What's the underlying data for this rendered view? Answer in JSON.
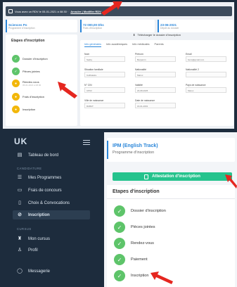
{
  "top_screen": {
    "rdv_bar": {
      "text": "Vous avez un RDV le 05-01-2021 à 08:30 ·",
      "link": "Annuler | Modifier RDV"
    },
    "stats": [
      {
        "value": "Sciences Po",
        "label": "Programme d'inscription"
      },
      {
        "value": "72 000,00 Dhs",
        "label": "Frais d'inscription"
      },
      {
        "value": "23-06-2021",
        "label": "Dépôt du dossier"
      }
    ],
    "download_label": "Télécharger le dossier d'inscription",
    "etapes_title": "Etapes d'inscription",
    "steps": [
      {
        "label": "Dossier d'inscription",
        "sub": "",
        "status": "done"
      },
      {
        "label": "Pièces jointes",
        "sub": "",
        "status": "done"
      },
      {
        "label": "Rendez-vous",
        "sub": "05-01-2021 à 08:30",
        "status": "pending"
      },
      {
        "label": "Frais d'inscription",
        "sub": "",
        "status": "pending"
      },
      {
        "label": "Inscription",
        "sub": "",
        "status": "pending"
      }
    ],
    "tabs": [
      "Info générales",
      "Info académiques",
      "Info médicales",
      "Parents"
    ],
    "fields": [
      {
        "label": "Nom",
        "value": "Sadiq"
      },
      {
        "label": "Prénom",
        "value": "Benjamin"
      },
      {
        "label": "Email",
        "value": "bens@gmail.com"
      },
      {
        "label": "Situation familiale",
        "value": "Célibataire"
      },
      {
        "label": "Nationalité",
        "value": "Maroc"
      },
      {
        "label": "Nationalité 2",
        "value": ""
      },
      {
        "label": "N° CIN",
        "value": "CP93"
      },
      {
        "label": "Validité",
        "value": "20-08-2025"
      },
      {
        "label": "Pays de naissance",
        "value": "Maroc"
      },
      {
        "label": "Ville de naissance",
        "value": "RABAT"
      },
      {
        "label": "Date de naissance",
        "value": "16-01-2001"
      }
    ]
  },
  "bottom_screen": {
    "logo": "UK",
    "nav": {
      "dashboard": "Tableau de bord",
      "section_candidature": "CANDIDATURE",
      "programmes": "Mes Programmes",
      "frais": "Frais de concours",
      "choix": "Choix & Convocations",
      "inscription": "Inscription",
      "section_cursus": "CURSUS",
      "mon_cursus": "Mon cursus",
      "profil": "Profil",
      "messagerie": "Messagerie"
    },
    "program": {
      "title": "IPM (English Track)",
      "subtitle": "Programme d'inscription"
    },
    "attestation_button": "Attestation d'inscription",
    "etapes_title": "Etapes d'inscription",
    "steps": [
      "Dossier d'inscription",
      "Pièces jointes",
      "Rendez-vous",
      "Paiement",
      "Inscription"
    ]
  },
  "colors": {
    "accent": "#2a86d9",
    "success": "#5ec46a",
    "pending": "#f2b70a",
    "attestation": "#25c38d",
    "arrow": "#e5261f",
    "sidebar": "#1d2c3d"
  }
}
